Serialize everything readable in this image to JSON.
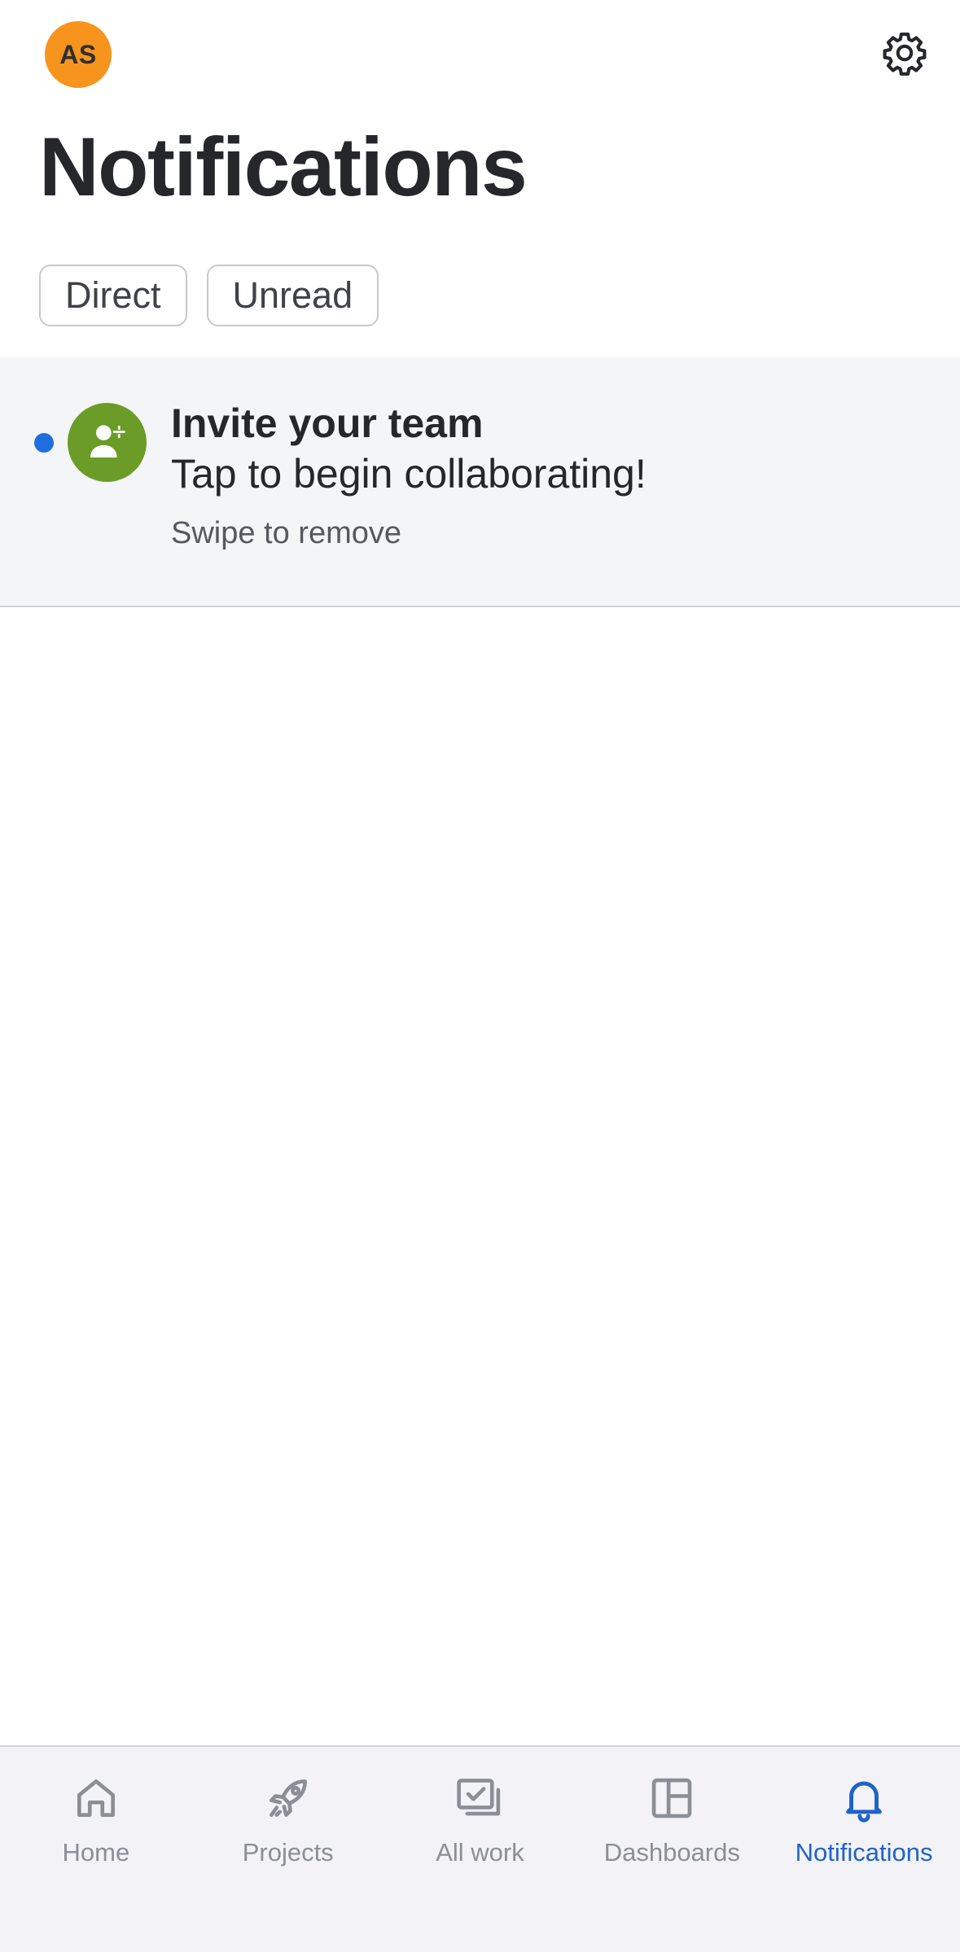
{
  "header": {
    "avatar_initials": "AS",
    "avatar_color": "#f7941d",
    "settings_icon": "gear-icon",
    "title": "Notifications"
  },
  "filters": [
    {
      "label": "Direct"
    },
    {
      "label": "Unread"
    }
  ],
  "notification": {
    "icon": "add-user-icon",
    "icon_color": "#6a9c27",
    "unread": true,
    "unread_color": "#1f6ee0",
    "title": "Invite your team",
    "body": "Tap to begin collaborating!",
    "hint": "Swipe to remove"
  },
  "tabbar": {
    "active_color": "#1f63c6",
    "items": [
      {
        "label": "Home",
        "icon": "home-icon",
        "active": false
      },
      {
        "label": "Projects",
        "icon": "rocket-icon",
        "active": false
      },
      {
        "label": "All work",
        "icon": "all-work-icon",
        "active": false
      },
      {
        "label": "Dashboards",
        "icon": "dashboard-icon",
        "active": false
      },
      {
        "label": "Notifications",
        "icon": "bell-icon",
        "active": true
      }
    ]
  }
}
